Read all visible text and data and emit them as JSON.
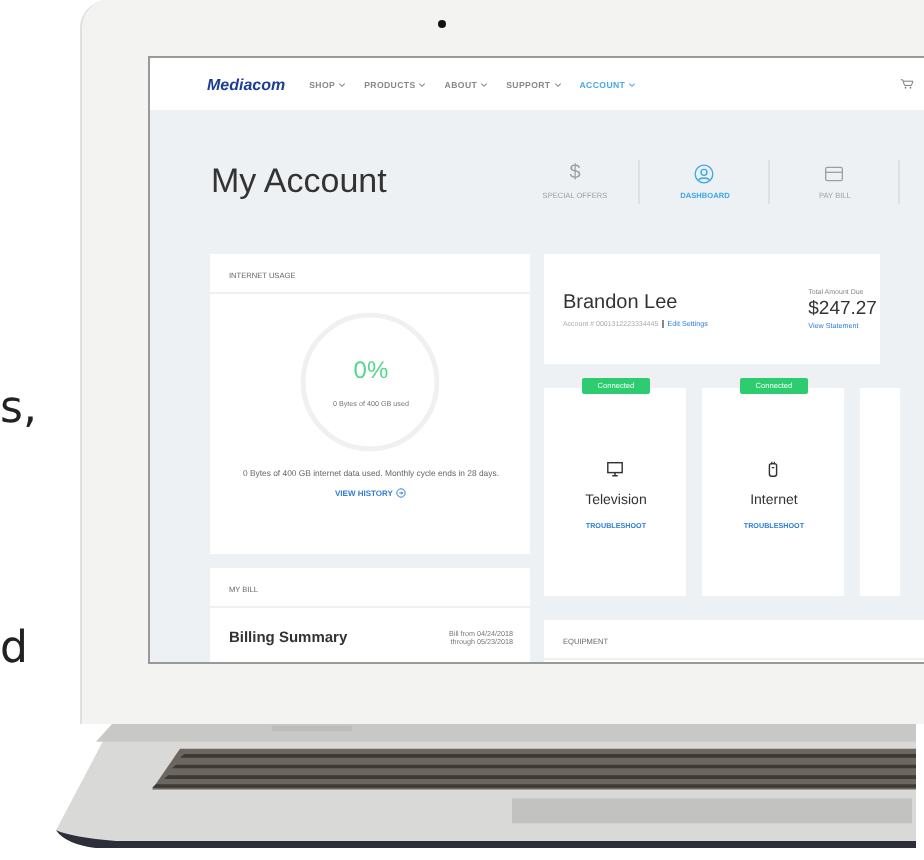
{
  "side_text": [
    "s,",
    "d"
  ],
  "nav": {
    "logo": "Mediacom",
    "items": [
      {
        "label": "SHOP",
        "selected": false
      },
      {
        "label": "PRODUCTS",
        "selected": false
      },
      {
        "label": "ABOUT",
        "selected": false
      },
      {
        "label": "SUPPORT",
        "selected": false
      },
      {
        "label": "ACCOUNT",
        "selected": true
      }
    ]
  },
  "page_title": "My Account",
  "quick_tabs": [
    {
      "kind": "glyph",
      "glyph": "$",
      "label": "SPECIAL OFFERS",
      "selected": false
    },
    {
      "kind": "user",
      "label": "DASHBOARD",
      "selected": true
    },
    {
      "kind": "card",
      "label": "PAY BILL",
      "selected": false
    }
  ],
  "internet_usage": {
    "title": "INTERNET USAGE",
    "percent": "0%",
    "ring_caption": "0 Bytes of 400 GB used",
    "summary": "0 Bytes of 400 GB internet data used. Monthly cycle ends in 28 days.",
    "link": "VIEW HISTORY"
  },
  "account": {
    "name": "Brandon Lee",
    "number": "Account # 0001312223334445",
    "settings_link": "Edit Settings",
    "due_label": "Total Amount Due",
    "amount": "$247.27",
    "statement_link": "View Statement"
  },
  "services": [
    {
      "kind": "tv",
      "status": "Connected",
      "connected": true,
      "name": "Television",
      "link": "TROUBLESHOOT"
    },
    {
      "kind": "modem",
      "status": "Connected",
      "connected": true,
      "name": "Internet",
      "link": "TROUBLESHOOT"
    },
    {
      "kind": "empty"
    }
  ],
  "bill": {
    "title": "MY BILL",
    "heading": "Billing Summary",
    "period": [
      "Bill from 04/24/2018",
      "through 05/23/2018"
    ]
  },
  "equipment": {
    "title": "EQUIPMENT"
  }
}
